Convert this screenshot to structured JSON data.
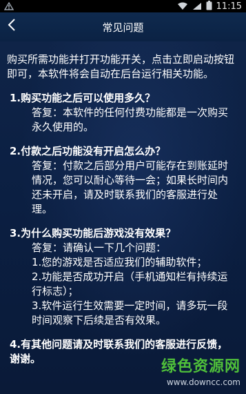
{
  "status": {
    "time": "11:15"
  },
  "header": {
    "title": "常见问题"
  },
  "content": {
    "intro": "购买所需功能并打开功能开关，点击立即启动按钮即可，本软件将会自动在后台运行相关功能。",
    "items": [
      {
        "question": "1.购买功能之后可以使用多久？",
        "answer": [
          "答复：本软件的任何付费功能都是一次购买永久使用的。"
        ]
      },
      {
        "question": "2.付款之后功能没有开启怎么办？",
        "answer": [
          "答复：付款之后部分用户可能存在到账延时情况，您可以耐心等待一会；如果长时间内还未开启，请及时联系我们的客服进行处理。"
        ]
      },
      {
        "question": "3.为什么购买功能后游戏没有效果？",
        "answer": [
          "答复：请确认一下几个问题：",
          "1.您的游戏是否适应我们的辅助软件；",
          "2.功能是否成功开启（手机通知栏有持续运行标志）；",
          "3.软件运行生效需要一定时间，请多玩一段时间观察下后续是否有效果。"
        ]
      },
      {
        "question": "4.有其他问题请及时联系我们的客服进行反馈，谢谢。",
        "answer": []
      }
    ]
  },
  "watermark": {
    "name": "绿色资源网",
    "url": "www.downcc.com"
  }
}
